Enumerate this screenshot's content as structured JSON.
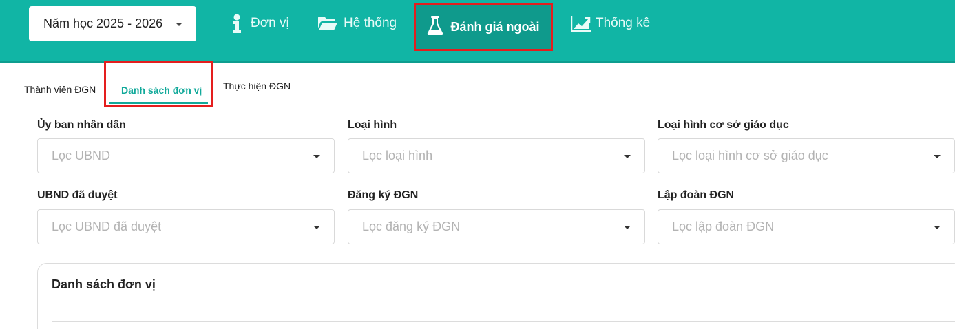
{
  "header": {
    "year_select": {
      "value": "Năm học 2025 - 2026",
      "icon": "caret-down-icon"
    },
    "nav": [
      {
        "label": "Đơn vị",
        "icon": "info-icon",
        "active": false
      },
      {
        "label": "Hệ thống",
        "icon": "folder-open-icon",
        "active": false
      },
      {
        "label": "Đánh giá ngoài",
        "icon": "flask-icon",
        "active": true
      },
      {
        "label": "Thống kê",
        "icon": "area-chart-icon",
        "active": false
      }
    ]
  },
  "tabs": [
    {
      "label": "Thành viên ĐGN",
      "active": false
    },
    {
      "label": "Danh sách đơn vị",
      "active": true
    },
    {
      "label": "Thực hiện ĐGN",
      "active": false
    }
  ],
  "filters": [
    {
      "label": "Ủy ban nhân dân",
      "placeholder": "Lọc UBND"
    },
    {
      "label": "Loại hình",
      "placeholder": "Lọc loại hình"
    },
    {
      "label": "Loại hình cơ sở giáo dục",
      "placeholder": "Lọc loại hình cơ sở giáo dục"
    },
    {
      "label": "UBND đã duyệt",
      "placeholder": "Lọc UBND đã duyệt"
    },
    {
      "label": "Đăng ký ĐGN",
      "placeholder": "Lọc đăng ký ĐGN"
    },
    {
      "label": "Lập đoàn ĐGN",
      "placeholder": "Lọc lập đoàn ĐGN"
    }
  ],
  "card": {
    "title": "Danh sách đơn vị"
  },
  "colors": {
    "header_bg": "#11b5a5",
    "header_active_bg": "#0f9a8c",
    "accent": "#11a99a",
    "highlight_border": "#e41e1e"
  }
}
